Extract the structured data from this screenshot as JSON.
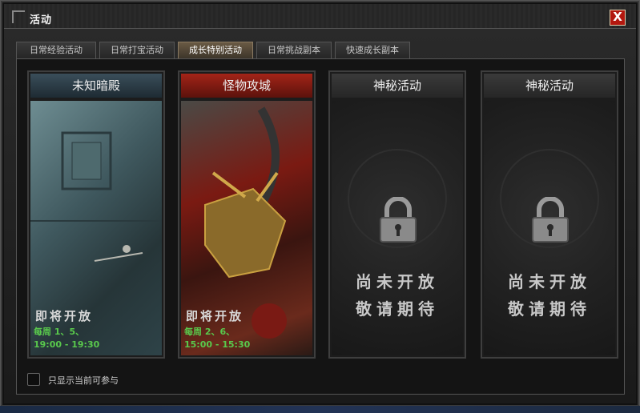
{
  "window": {
    "title": "活动",
    "close_label": "X"
  },
  "tabs": [
    {
      "label": "日常经验活动",
      "active": false
    },
    {
      "label": "日常打宝活动",
      "active": false
    },
    {
      "label": "成长特别活动",
      "active": true
    },
    {
      "label": "日常挑战副本",
      "active": false
    },
    {
      "label": "快速成长副本",
      "active": false
    }
  ],
  "cards": [
    {
      "title": "未知暗殿",
      "status": "即将开放",
      "days": "每周 1、5、",
      "time": "19:00 - 19:30"
    },
    {
      "title": "怪物攻城",
      "status": "即将开放",
      "days": "每周 2、6、",
      "time": "15:00 - 15:30"
    },
    {
      "title": "神秘活动",
      "line1": "尚未开放",
      "line2": "敬请期待"
    },
    {
      "title": "神秘活动",
      "line1": "尚未开放",
      "line2": "敬请期待"
    }
  ],
  "filter": {
    "label": "只显示当前可参与",
    "checked": false
  },
  "colors": {
    "accent_green": "#59c94c",
    "close_red": "#b3180f",
    "active_tab": "#6a5a44"
  }
}
